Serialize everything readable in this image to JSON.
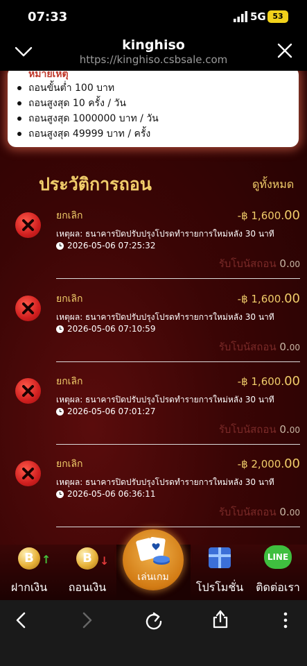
{
  "status_bar": {
    "time": "07:33",
    "network": "5G",
    "battery": "53"
  },
  "browser_header": {
    "title": "kinghiso",
    "url": "https://kinghiso.csbsale.com"
  },
  "notice": {
    "heading": "หมายเหตุ",
    "items": [
      "ถอนขั้นต่ำ 100 บาท",
      "ถอนสูงสุด 10 ครั้ง / วัน",
      "ถอนสูงสุด 1000000 บาท / วัน",
      "ถอนสูงสุด 49999 บาท / ครั้ง"
    ]
  },
  "history": {
    "title": "ประวัติการถอน",
    "view_all": "ดูทั้งหมด",
    "records": [
      {
        "status": "ยกเลิก",
        "amount_main": "-฿ 1,600.",
        "amount_cents": "00",
        "reason": "เหตุผล: ธนาคารปิดปรับปรุงโปรดทำรายการใหม่หลัง 30 นาที",
        "time": "2026-05-06 07:25:32",
        "bonus_label": "รับโบนัสถอน",
        "bonus_main": "0.",
        "bonus_cents": "00"
      },
      {
        "status": "ยกเลิก",
        "amount_main": "-฿ 1,600.",
        "amount_cents": "00",
        "reason": "เหตุผล: ธนาคารปิดปรับปรุงโปรดทำรายการใหม่หลัง 30 นาที",
        "time": "2026-05-06 07:10:59",
        "bonus_label": "รับโบนัสถอน",
        "bonus_main": "0.",
        "bonus_cents": "00"
      },
      {
        "status": "ยกเลิก",
        "amount_main": "-฿ 1,600.",
        "amount_cents": "00",
        "reason": "เหตุผล: ธนาคารปิดปรับปรุงโปรดทำรายการใหม่หลัง 30 นาที",
        "time": "2026-05-06 07:01:27",
        "bonus_label": "รับโบนัสถอน",
        "bonus_main": "0.",
        "bonus_cents": "00"
      },
      {
        "status": "ยกเลิก",
        "amount_main": "-฿ 2,000.",
        "amount_cents": "00",
        "reason": "เหตุผล: ธนาคารปิดปรับปรุงโปรดทำรายการใหม่หลัง 30 นาที",
        "time": "2026-05-06 06:36:11",
        "bonus_label": "รับโบนัสถอน",
        "bonus_main": "0.",
        "bonus_cents": "00"
      }
    ]
  },
  "bottom_menu": {
    "deposit": "ฝากเงิน",
    "withdraw": "ถอนเงิน",
    "play": "เล่นเกม",
    "promotion": "โปรโมชั่น",
    "contact": "ติดต่อเรา",
    "line_logo": "LINE",
    "coin_letter": "B"
  },
  "colors": {
    "gold": "#f1cd6a",
    "cancel_red": "#d01f1f",
    "page_bg": "#3a0505"
  }
}
